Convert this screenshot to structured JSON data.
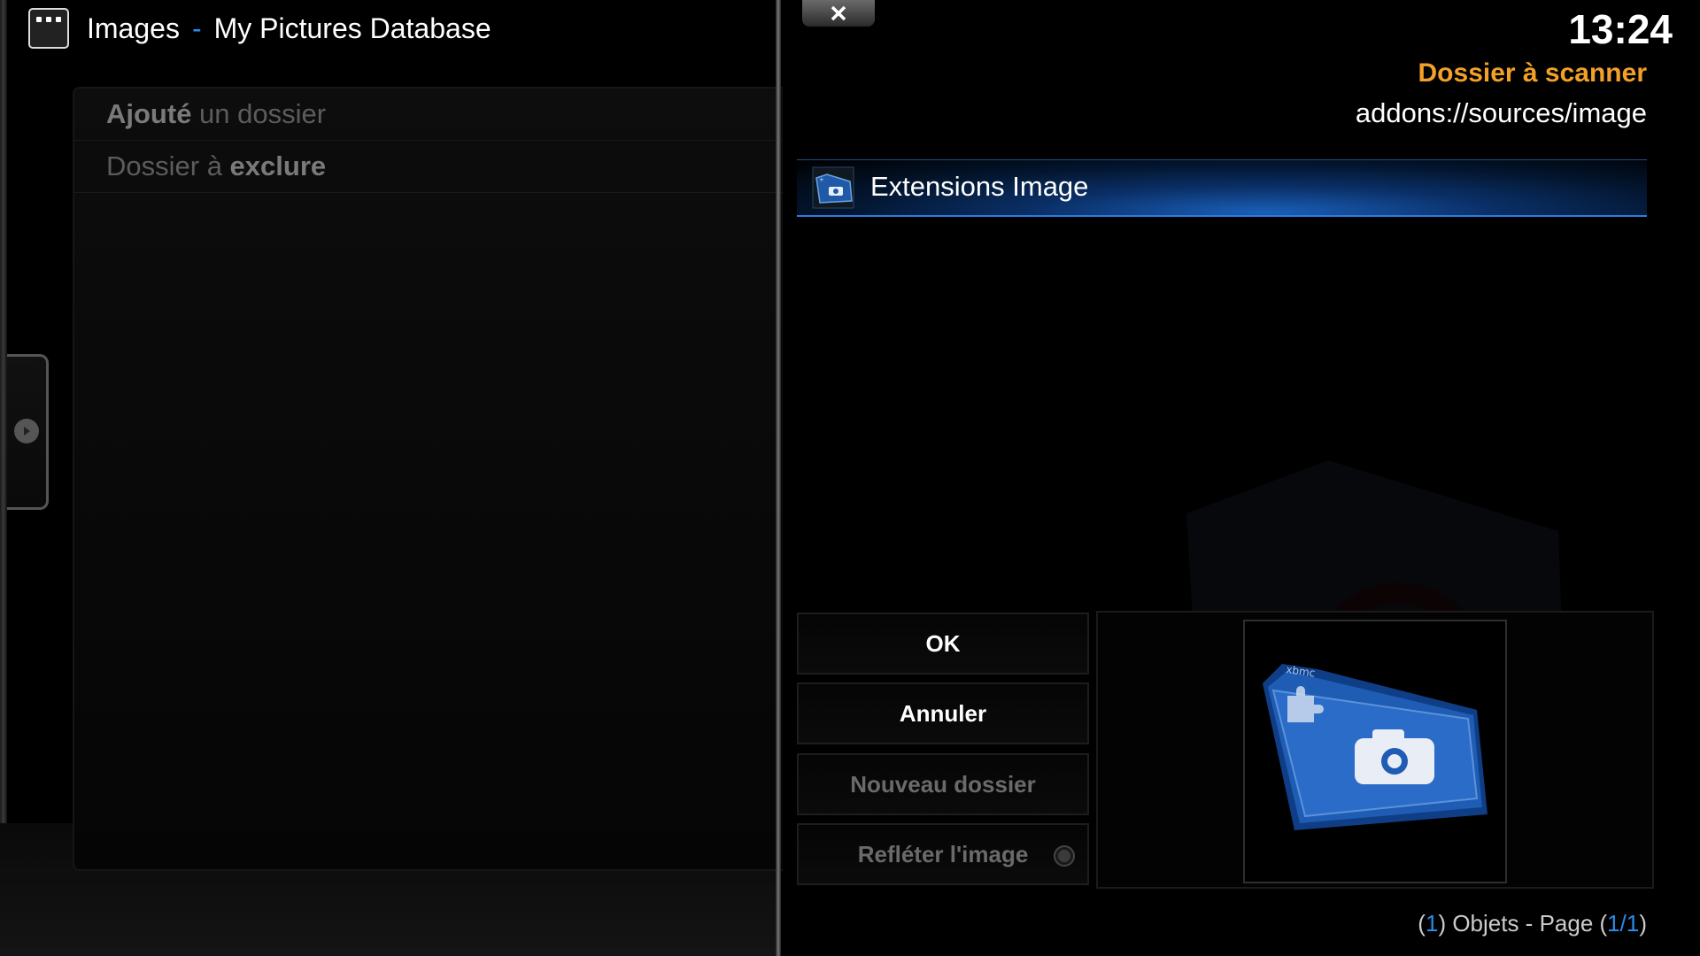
{
  "header": {
    "section": "Images",
    "separator": "-",
    "subtitle": "My Pictures Database",
    "icon": "menu-dots-icon"
  },
  "left_list": {
    "items": [
      {
        "bold": "Ajouté",
        "light": " un dossier",
        "order": "bold-first"
      },
      {
        "light": "Dossier à ",
        "bold": "exclure",
        "order": "light-first"
      }
    ]
  },
  "dialog": {
    "clock": "13:24",
    "title": "Dossier à scanner",
    "path": "addons://sources/image",
    "selected_item": {
      "label": "Extensions Image",
      "icon": "folder-camera-icon"
    },
    "buttons": {
      "ok": "OK",
      "cancel": "Annuler",
      "new_folder": "Nouveau dossier",
      "mirror": "Refléter l'image"
    },
    "mirror_enabled": false,
    "thumbnail_icon": "xbmc-image-addon-folder-icon",
    "thumbnail_badge": "xbmc",
    "footer": {
      "open1": "(",
      "count": "1",
      "mid": ") Objets - Page (",
      "page": "1/1",
      "close": ")"
    }
  },
  "colors": {
    "accent_blue": "#2a8be8",
    "title_orange": "#f2a028",
    "selection_blue": "#1a5fb8"
  }
}
